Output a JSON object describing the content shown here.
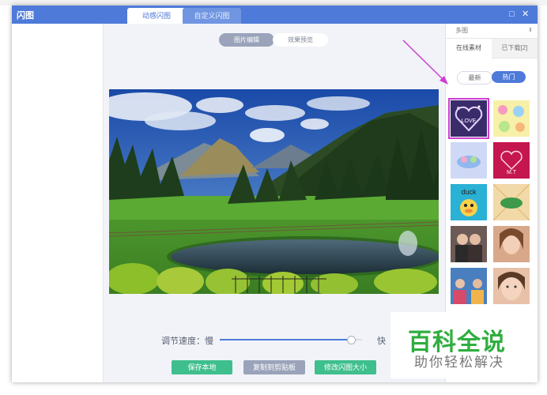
{
  "window": {
    "title": "闪图",
    "tabs": [
      {
        "label": "动感闪图",
        "active": true
      },
      {
        "label": "自定义闪图",
        "active": false
      }
    ],
    "min_glyph": "□",
    "close_glyph": "✕"
  },
  "editor": {
    "modes": [
      {
        "label": "图片编辑",
        "active": true
      },
      {
        "label": "效果预览",
        "active": false
      }
    ],
    "speed": {
      "label": "调节速度：慢",
      "fast_label": "快",
      "value": 0.92
    },
    "buttons": {
      "save": "保存本地",
      "copy": "复制到剪贴板",
      "resize": "修改闪图大小"
    }
  },
  "material_panel": {
    "dropdown_value": "多图",
    "tabs": [
      {
        "label": "在线素材",
        "active": true
      },
      {
        "label": "已下载[2]",
        "active": false
      }
    ],
    "sort": [
      {
        "label": "最新",
        "active": false
      },
      {
        "label": "热门",
        "active": true
      }
    ],
    "thumb_text": {
      "love": "LOVE",
      "mt": "M.T",
      "duck": "duck"
    },
    "selected_index": 0
  },
  "watermark": {
    "main": "百科全说",
    "sub": "助你轻松解决"
  },
  "colors": {
    "titlebar": "#4e7ad9",
    "accent_green": "#3fbf8e",
    "selection": "#cc3fd0",
    "arrow": "#cc3fd0",
    "watermark_green": "#2fae3f"
  }
}
